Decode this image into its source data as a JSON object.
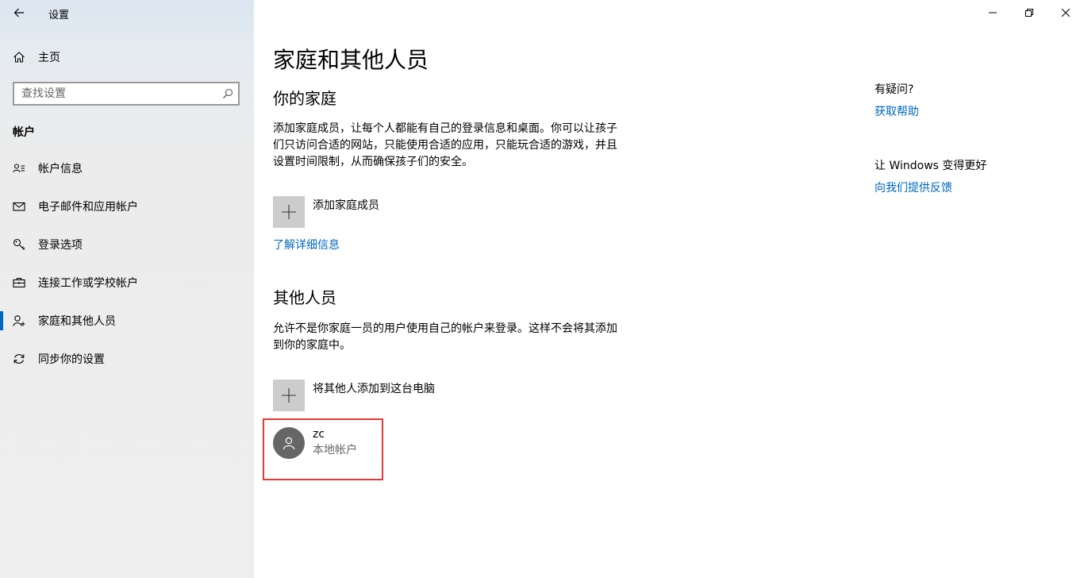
{
  "window": {
    "title": "设置"
  },
  "sidebar": {
    "home_label": "主页",
    "search": {
      "value": "",
      "placeholder": "查找设置"
    },
    "section_title": "帐户",
    "items": [
      {
        "label": "帐户信息",
        "icon": "account-info-icon"
      },
      {
        "label": "电子邮件和应用帐户",
        "icon": "mail-icon"
      },
      {
        "label": "登录选项",
        "icon": "key-icon"
      },
      {
        "label": "连接工作或学校帐户",
        "icon": "briefcase-icon"
      },
      {
        "label": "家庭和其他人员",
        "icon": "person-add-icon",
        "active": true
      },
      {
        "label": "同步你的设置",
        "icon": "sync-icon"
      }
    ]
  },
  "main": {
    "title": "家庭和其他人员",
    "family": {
      "heading": "你的家庭",
      "description": "添加家庭成员，让每个人都能有自己的登录信息和桌面。你可以让孩子们只访问合适的网站，只能使用合适的应用，只能玩合适的游戏，并且设置时间限制，从而确保孩子们的安全。",
      "add_label": "添加家庭成员",
      "learn_more": "了解详细信息"
    },
    "others": {
      "heading": "其他人员",
      "description": "允许不是你家庭一员的用户使用自己的帐户来登录。这样不会将其添加到你的家庭中。",
      "add_label": "将其他人添加到这台电脑",
      "users": [
        {
          "name": "zc",
          "type": "本地帐户"
        }
      ]
    }
  },
  "aside": {
    "question_heading": "有疑问?",
    "help_link": "获取帮助",
    "feedback_heading": "让 Windows 变得更好",
    "feedback_link": "向我们提供反馈"
  },
  "colors": {
    "accent": "#0067c0",
    "highlight": "#e53935",
    "tile": "#cccccc",
    "avatar": "#666666"
  }
}
